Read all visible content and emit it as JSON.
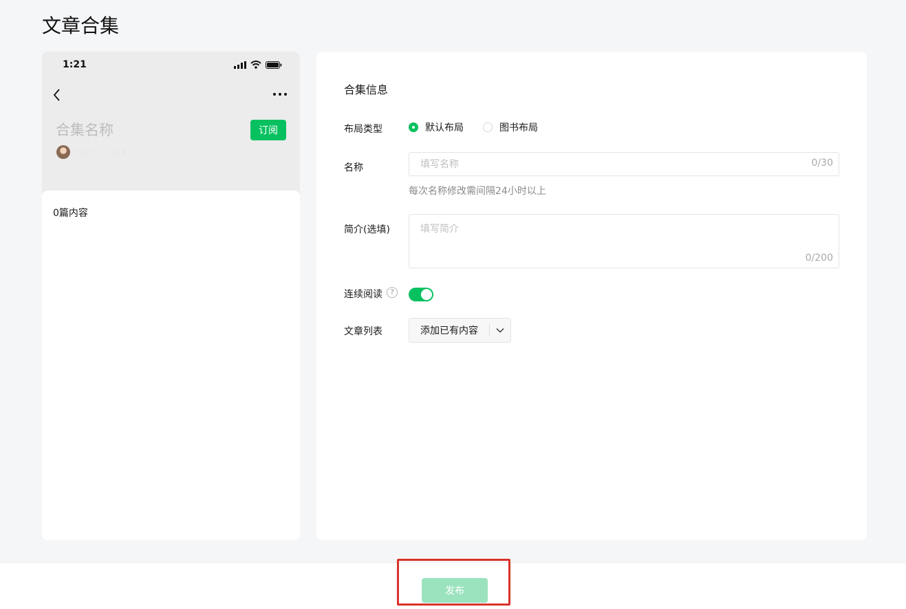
{
  "page": {
    "title": "文章合集"
  },
  "preview": {
    "status_time": "1:21",
    "collection_name": "合集名称",
    "subscribe_label": "订阅",
    "author_name": "南陌生人说",
    "author_chevron": "›",
    "content_count": "0篇内容"
  },
  "form": {
    "section_title": "合集信息",
    "layout": {
      "label": "布局类型",
      "options": [
        {
          "label": "默认布局",
          "selected": true
        },
        {
          "label": "图书布局",
          "selected": false
        }
      ]
    },
    "name": {
      "label": "名称",
      "value": "",
      "placeholder": "填写名称",
      "counter": "0/30",
      "hint": "每次名称修改需间隔24小时以上"
    },
    "intro": {
      "label": "简介(选填)",
      "value": "",
      "placeholder": "填写简介",
      "counter": "0/200"
    },
    "continuous": {
      "label": "连续阅读",
      "help": "?",
      "enabled": true
    },
    "article_list": {
      "label": "文章列表",
      "dropdown_label": "添加已有内容"
    }
  },
  "footer": {
    "publish_label": "发布"
  },
  "colors": {
    "accent": "#07c160",
    "accent_disabled": "#9be2bf",
    "highlight": "#d9322b"
  },
  "icons": [
    "back-icon",
    "more-icon",
    "signal-icon",
    "wifi-icon",
    "battery-icon",
    "help-icon",
    "chevron-down-icon"
  ]
}
